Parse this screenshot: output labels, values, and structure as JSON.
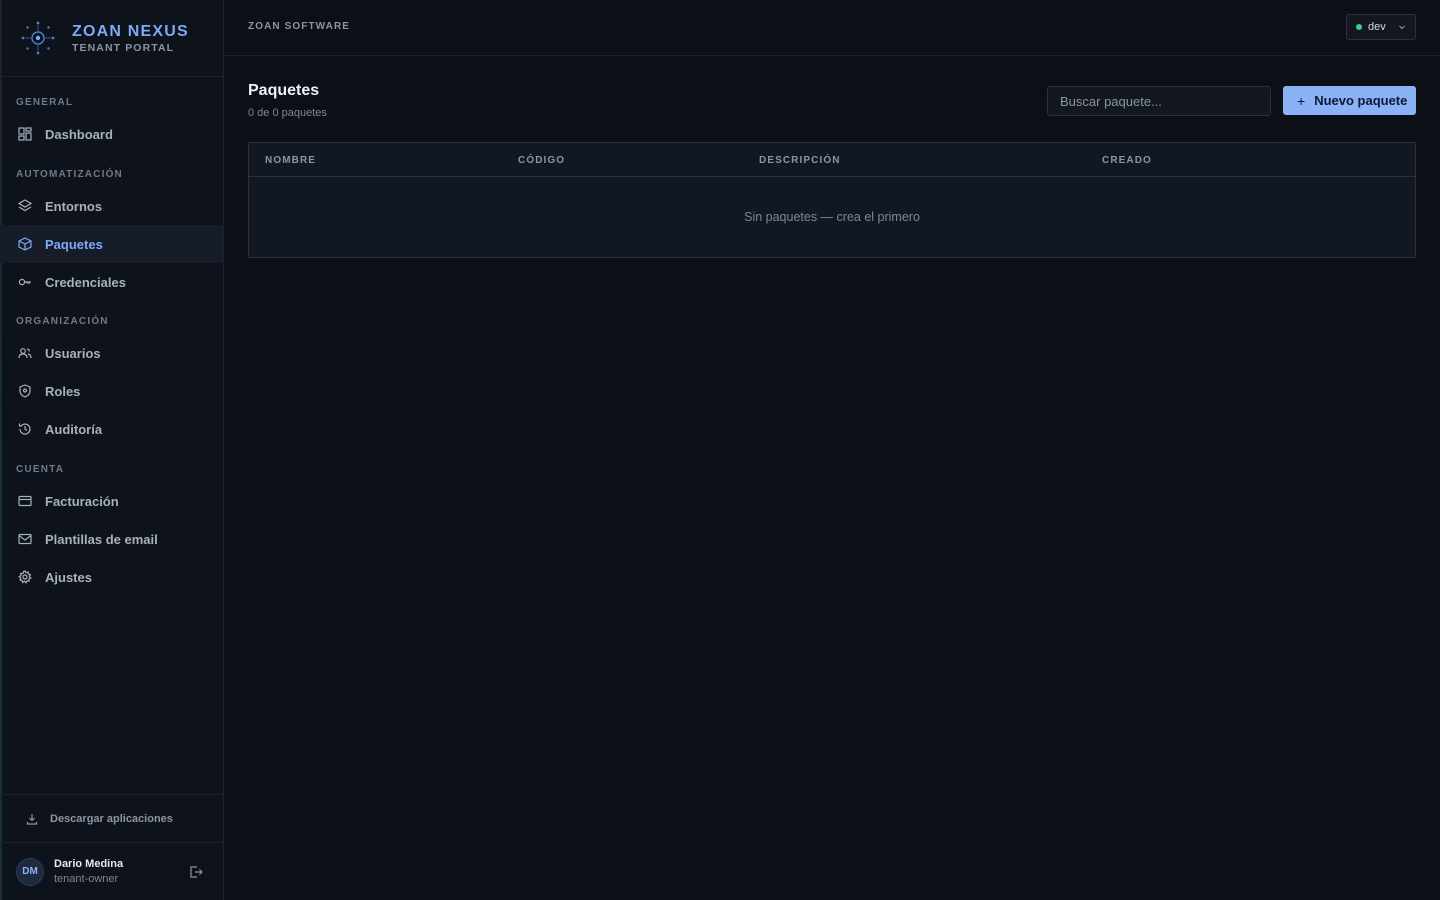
{
  "brand": {
    "title": "ZOAN NEXUS",
    "subtitle": "TENANT PORTAL"
  },
  "sidebar": {
    "sections": [
      {
        "label": "GENERAL",
        "items": [
          {
            "label": "Dashboard",
            "icon": "dashboard-icon"
          }
        ]
      },
      {
        "label": "AUTOMATIZACIÓN",
        "items": [
          {
            "label": "Entornos",
            "icon": "layers-icon"
          },
          {
            "label": "Paquetes",
            "icon": "package-icon",
            "active": true
          },
          {
            "label": "Credenciales",
            "icon": "key-icon"
          }
        ]
      },
      {
        "label": "ORGANIZACIÓN",
        "items": [
          {
            "label": "Usuarios",
            "icon": "users-icon"
          },
          {
            "label": "Roles",
            "icon": "shield-icon"
          },
          {
            "label": "Auditoría",
            "icon": "history-icon"
          }
        ]
      },
      {
        "label": "CUENTA",
        "items": [
          {
            "label": "Facturación",
            "icon": "credit-card-icon"
          },
          {
            "label": "Plantillas de email",
            "icon": "mail-icon"
          },
          {
            "label": "Ajustes",
            "icon": "gear-icon"
          }
        ]
      }
    ],
    "download_label": "Descargar aplicaciones",
    "user": {
      "initials": "DM",
      "name": "Dario Medina",
      "role": "tenant-owner"
    }
  },
  "topbar": {
    "company": "ZOAN SOFTWARE",
    "environment": "dev"
  },
  "main": {
    "title": "Paquetes",
    "count": "0 de 0 paquetes",
    "search_placeholder": "Buscar paquete...",
    "new_button": "Nuevo paquete",
    "table": {
      "columns": [
        "NOMBRE",
        "CÓDIGO",
        "DESCRIPCIÓN",
        "CREADO"
      ],
      "empty_message": "Sin paquetes — crea el primero"
    }
  },
  "colors": {
    "accent": "#7ea9f5",
    "button": "#8bb2f7",
    "status_dot": "#3ecf8e",
    "background": "#0c0f15"
  }
}
